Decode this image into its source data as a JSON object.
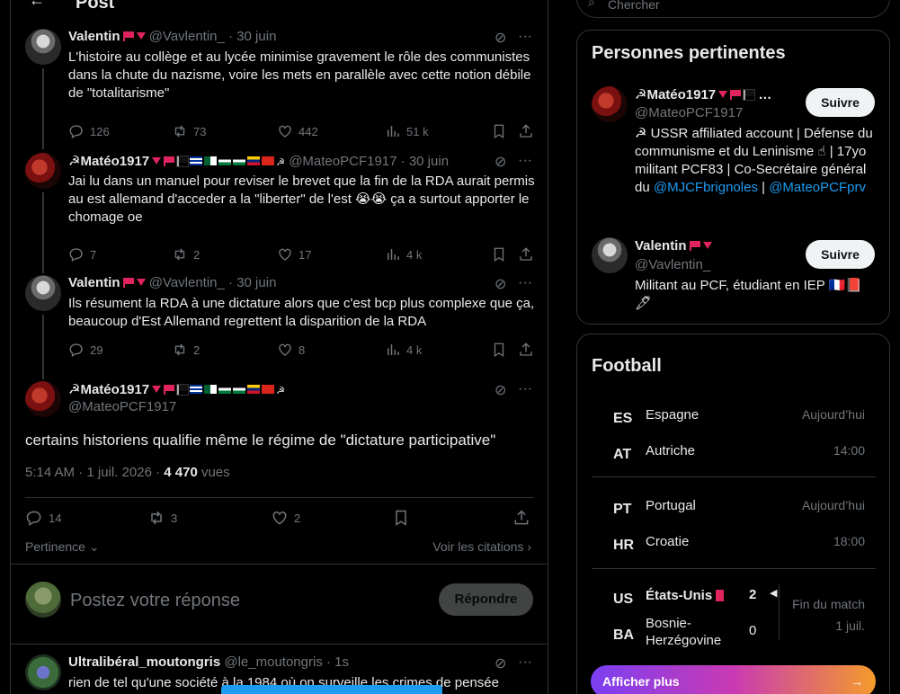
{
  "header": {
    "title": "Post"
  },
  "search": {
    "placeholder": "Chercher"
  },
  "tweets": [
    {
      "name": "Valentin",
      "handle": "@Vavlentin_",
      "date": "· 30 juin",
      "text": "L'histoire au collège et au lycée minimise gravement le rôle des communistes dans la chute du nazisme, voire les mets en parallèle avec cette notion débile de \"totalitarisme\"",
      "replies": "126",
      "reposts": "73",
      "likes": "442",
      "views": "51 k"
    },
    {
      "name": "☭Matéo1917",
      "handle": "@MateoPCF1917",
      "date": "· 30 juin",
      "text": "Jai lu dans un manuel pour reviser le brevet que la fin de la RDA aurait permis au est allemand d'acceder a la \"liberter\" de l'est 😭😭 ça a surtout apporter le chomage oe",
      "replies": "7",
      "reposts": "2",
      "likes": "17",
      "views": "4 k"
    },
    {
      "name": "Valentin",
      "handle": "@Vavlentin_",
      "date": "· 30 juin",
      "text": "Ils résument la RDA à une dictature alors que c'est bcp plus complexe que ça, beaucoup d'Est Allemand regrettent la disparition de la RDA",
      "replies": "29",
      "reposts": "2",
      "likes": "8",
      "views": "4 k"
    }
  ],
  "focus": {
    "name": "☭Matéo1917",
    "handle": "@MateoPCF1917",
    "text": "certains historiens qualifie même le régime de \"dictature participative\"",
    "meta_prefix": "5:14 AM · 1 juil. 2026 · ",
    "views_count": "4 470",
    "views_label": " vues",
    "replies": "14",
    "reposts": "3",
    "likes": "2",
    "sort_label": "Pertinence",
    "quotes_label": "Voir les citations"
  },
  "reply": {
    "placeholder": "Postez votre réponse",
    "button": "Répondre"
  },
  "last_tweet": {
    "name": "Ultralibéral_moutongris",
    "handle": "@le_moutongris",
    "date": "· 1s",
    "text": "rien de tel qu'une société à la 1984 où on surveille les crimes de pensée"
  },
  "people": {
    "title": "Personnes pertinentes",
    "items": [
      {
        "name": "☭Matéo1917",
        "handle": "@MateoPCF1917",
        "follow": "Suivre",
        "bio_pre": "☭ USSR affiliated account | Défense du communisme et du Leninisme ☝ | 17yo militant PCF83 | Co-Secrétaire général du ",
        "link1": "@MJCFbrignoles",
        "bio_mid": " | ",
        "link2": "@MateoPCFprv"
      },
      {
        "name": "Valentin",
        "handle": "@Vavlentin_",
        "follow": "Suivre",
        "bio": "Militant au PCF, étudiant en IEP 🇫🇷📕 🖋"
      }
    ]
  },
  "football": {
    "title": "Football",
    "matches": [
      {
        "c1": "ES",
        "t1": "Espagne",
        "c2": "AT",
        "t2": "Autriche",
        "w1": "Aujourd’hui",
        "w2": "14:00"
      },
      {
        "c1": "PT",
        "t1": "Portugal",
        "c2": "HR",
        "t2": "Croatie",
        "w1": "Aujourd’hui",
        "w2": "18:00"
      },
      {
        "c1": "US",
        "t1": "États-Unis",
        "s1": "2",
        "c2": "BA",
        "t2": "Bosnie-Herzégovine",
        "s2": "0",
        "w1": "Fin du match",
        "w2": "1 juil."
      }
    ],
    "show_more": "Afficher plus"
  },
  "colors": {
    "accent": "#1d9bf0",
    "flag_red": "#e0245e"
  }
}
